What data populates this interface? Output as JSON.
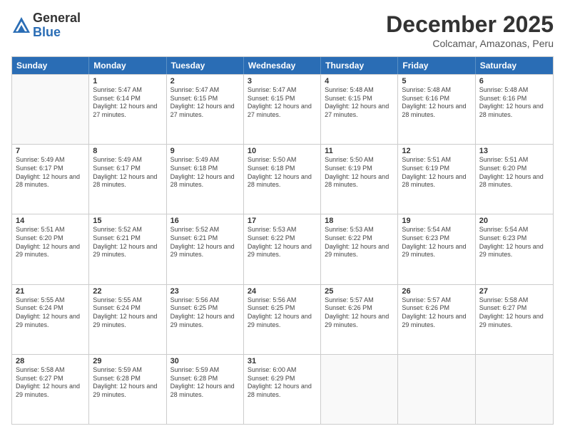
{
  "logo": {
    "general": "General",
    "blue": "Blue"
  },
  "title": "December 2025",
  "subtitle": "Colcamar, Amazonas, Peru",
  "header_days": [
    "Sunday",
    "Monday",
    "Tuesday",
    "Wednesday",
    "Thursday",
    "Friday",
    "Saturday"
  ],
  "weeks": [
    [
      {
        "day": "",
        "info": ""
      },
      {
        "day": "1",
        "info": "Sunrise: 5:47 AM\nSunset: 6:14 PM\nDaylight: 12 hours\nand 27 minutes."
      },
      {
        "day": "2",
        "info": "Sunrise: 5:47 AM\nSunset: 6:15 PM\nDaylight: 12 hours\nand 27 minutes."
      },
      {
        "day": "3",
        "info": "Sunrise: 5:47 AM\nSunset: 6:15 PM\nDaylight: 12 hours\nand 27 minutes."
      },
      {
        "day": "4",
        "info": "Sunrise: 5:48 AM\nSunset: 6:15 PM\nDaylight: 12 hours\nand 27 minutes."
      },
      {
        "day": "5",
        "info": "Sunrise: 5:48 AM\nSunset: 6:16 PM\nDaylight: 12 hours\nand 28 minutes."
      },
      {
        "day": "6",
        "info": "Sunrise: 5:48 AM\nSunset: 6:16 PM\nDaylight: 12 hours\nand 28 minutes."
      }
    ],
    [
      {
        "day": "7",
        "info": "Sunrise: 5:49 AM\nSunset: 6:17 PM\nDaylight: 12 hours\nand 28 minutes."
      },
      {
        "day": "8",
        "info": "Sunrise: 5:49 AM\nSunset: 6:17 PM\nDaylight: 12 hours\nand 28 minutes."
      },
      {
        "day": "9",
        "info": "Sunrise: 5:49 AM\nSunset: 6:18 PM\nDaylight: 12 hours\nand 28 minutes."
      },
      {
        "day": "10",
        "info": "Sunrise: 5:50 AM\nSunset: 6:18 PM\nDaylight: 12 hours\nand 28 minutes."
      },
      {
        "day": "11",
        "info": "Sunrise: 5:50 AM\nSunset: 6:19 PM\nDaylight: 12 hours\nand 28 minutes."
      },
      {
        "day": "12",
        "info": "Sunrise: 5:51 AM\nSunset: 6:19 PM\nDaylight: 12 hours\nand 28 minutes."
      },
      {
        "day": "13",
        "info": "Sunrise: 5:51 AM\nSunset: 6:20 PM\nDaylight: 12 hours\nand 28 minutes."
      }
    ],
    [
      {
        "day": "14",
        "info": "Sunrise: 5:51 AM\nSunset: 6:20 PM\nDaylight: 12 hours\nand 29 minutes."
      },
      {
        "day": "15",
        "info": "Sunrise: 5:52 AM\nSunset: 6:21 PM\nDaylight: 12 hours\nand 29 minutes."
      },
      {
        "day": "16",
        "info": "Sunrise: 5:52 AM\nSunset: 6:21 PM\nDaylight: 12 hours\nand 29 minutes."
      },
      {
        "day": "17",
        "info": "Sunrise: 5:53 AM\nSunset: 6:22 PM\nDaylight: 12 hours\nand 29 minutes."
      },
      {
        "day": "18",
        "info": "Sunrise: 5:53 AM\nSunset: 6:22 PM\nDaylight: 12 hours\nand 29 minutes."
      },
      {
        "day": "19",
        "info": "Sunrise: 5:54 AM\nSunset: 6:23 PM\nDaylight: 12 hours\nand 29 minutes."
      },
      {
        "day": "20",
        "info": "Sunrise: 5:54 AM\nSunset: 6:23 PM\nDaylight: 12 hours\nand 29 minutes."
      }
    ],
    [
      {
        "day": "21",
        "info": "Sunrise: 5:55 AM\nSunset: 6:24 PM\nDaylight: 12 hours\nand 29 minutes."
      },
      {
        "day": "22",
        "info": "Sunrise: 5:55 AM\nSunset: 6:24 PM\nDaylight: 12 hours\nand 29 minutes."
      },
      {
        "day": "23",
        "info": "Sunrise: 5:56 AM\nSunset: 6:25 PM\nDaylight: 12 hours\nand 29 minutes."
      },
      {
        "day": "24",
        "info": "Sunrise: 5:56 AM\nSunset: 6:25 PM\nDaylight: 12 hours\nand 29 minutes."
      },
      {
        "day": "25",
        "info": "Sunrise: 5:57 AM\nSunset: 6:26 PM\nDaylight: 12 hours\nand 29 minutes."
      },
      {
        "day": "26",
        "info": "Sunrise: 5:57 AM\nSunset: 6:26 PM\nDaylight: 12 hours\nand 29 minutes."
      },
      {
        "day": "27",
        "info": "Sunrise: 5:58 AM\nSunset: 6:27 PM\nDaylight: 12 hours\nand 29 minutes."
      }
    ],
    [
      {
        "day": "28",
        "info": "Sunrise: 5:58 AM\nSunset: 6:27 PM\nDaylight: 12 hours\nand 29 minutes."
      },
      {
        "day": "29",
        "info": "Sunrise: 5:59 AM\nSunset: 6:28 PM\nDaylight: 12 hours\nand 29 minutes."
      },
      {
        "day": "30",
        "info": "Sunrise: 5:59 AM\nSunset: 6:28 PM\nDaylight: 12 hours\nand 28 minutes."
      },
      {
        "day": "31",
        "info": "Sunrise: 6:00 AM\nSunset: 6:29 PM\nDaylight: 12 hours\nand 28 minutes."
      },
      {
        "day": "",
        "info": ""
      },
      {
        "day": "",
        "info": ""
      },
      {
        "day": "",
        "info": ""
      }
    ]
  ]
}
